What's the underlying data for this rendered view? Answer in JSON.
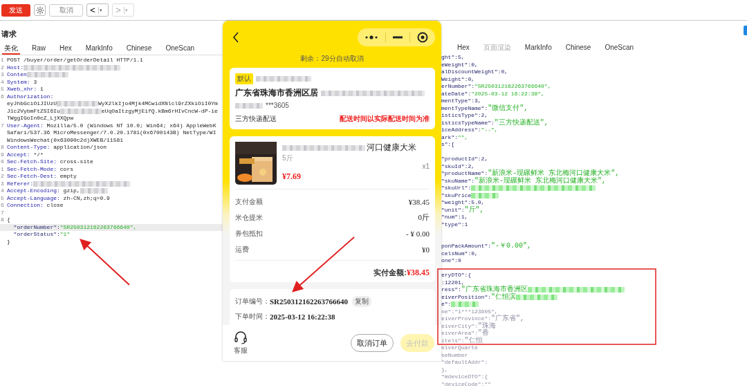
{
  "toolbar": {
    "send": "发送",
    "cancel": "取消",
    "back": "<",
    "forward": ">",
    "caret": "▾"
  },
  "request": {
    "title": "请求",
    "tabs": [
      {
        "label": "美化",
        "selected": true
      },
      {
        "label": "Raw",
        "selected": false
      },
      {
        "label": "Hex",
        "selected": false
      },
      {
        "label": "MarkInfo",
        "selected": false
      },
      {
        "label": "Chinese",
        "selected": false
      },
      {
        "label": "OneScan",
        "selected": false
      }
    ],
    "lines": [
      {
        "no": "1",
        "highlighted": false,
        "parts": [
          {
            "t": "POST /buyer/order/getOrderDetail HTTP/1.1",
            "kind": "plain"
          }
        ]
      },
      {
        "no": "2",
        "highlighted": false,
        "parts": [
          {
            "t": "Host:",
            "kind": "key"
          },
          {
            "kind": "blur-long"
          }
        ]
      },
      {
        "no": "3",
        "highlighted": false,
        "parts": [
          {
            "t": "Conten",
            "kind": "key"
          },
          {
            "kind": "blur-medium"
          }
        ]
      },
      {
        "no": "4",
        "highlighted": false,
        "parts": [
          {
            "t": "System:",
            "kind": "key"
          },
          {
            "t": " 3",
            "kind": "plain"
          }
        ]
      },
      {
        "no": "5",
        "highlighted": false,
        "parts": [
          {
            "t": "Xweb_xhr:",
            "kind": "key"
          },
          {
            "t": " 1",
            "kind": "plain"
          }
        ]
      },
      {
        "no": "6",
        "highlighted": false,
        "parts": [
          {
            "t": "Authorization:",
            "kind": "key"
          }
        ]
      },
      {
        "highlighted": false,
        "parts": [
          {
            "t": "eyJhbGciOiJIUzU",
            "kind": "plain"
          },
          {
            "kind": "blur-medium"
          },
          {
            "t": "WyX2lkIjo4Mjk4MCwidXNlcl9rZXkiOiI0Ym",
            "kind": "plain"
          }
        ]
      },
      {
        "highlighted": false,
        "parts": [
          {
            "t": "J1c2VybmFtZSI6Iu",
            "kind": "plain"
          },
          {
            "kind": "blur-medium"
          },
          {
            "t": "eUqOaItzgyMjEifQ.kBm6rHIvCncW-dP-ie",
            "kind": "plain"
          }
        ]
      },
      {
        "highlighted": false,
        "parts": [
          {
            "t": "TWggIGoIn0cZ_LjXXQpw",
            "kind": "plain"
          }
        ]
      },
      {
        "no": "7",
        "highlighted": false,
        "parts": [
          {
            "t": "User-Agent:",
            "kind": "key"
          },
          {
            "t": " Mozilla/5.0 (Windows NT 10.0; Win64; x64) AppleWebK",
            "kind": "plain"
          }
        ]
      },
      {
        "highlighted": false,
        "parts": [
          {
            "t": "Safari/537.36 MicroMessenger/7.0.20.1781(0x6700143B) NetType/WI",
            "kind": "plain"
          }
        ]
      },
      {
        "highlighted": false,
        "parts": [
          {
            "t": "WindowsWechat(0x63090c2d)XWEB/11581",
            "kind": "plain"
          }
        ]
      },
      {
        "no": "8",
        "highlighted": false,
        "parts": [
          {
            "t": "Content-Type:",
            "kind": "key"
          },
          {
            "t": " application/json",
            "kind": "plain"
          }
        ]
      },
      {
        "no": "9",
        "highlighted": false,
        "parts": [
          {
            "t": "Accept:",
            "kind": "key"
          },
          {
            "t": " */*",
            "kind": "plain"
          }
        ]
      },
      {
        "no": "0",
        "highlighted": false,
        "parts": [
          {
            "t": "Sec-Fetch-Site:",
            "kind": "key"
          },
          {
            "t": " cross-site",
            "kind": "plain"
          }
        ]
      },
      {
        "no": "1",
        "highlighted": false,
        "parts": [
          {
            "t": "Sec-Fetch-Mode:",
            "kind": "key"
          },
          {
            "t": " cors",
            "kind": "plain"
          }
        ]
      },
      {
        "no": "2",
        "highlighted": false,
        "parts": [
          {
            "t": "Sec-Fetch-Dest:",
            "kind": "key"
          },
          {
            "t": " empty",
            "kind": "plain"
          }
        ]
      },
      {
        "no": "3",
        "highlighted": false,
        "parts": [
          {
            "t": "Referer:",
            "kind": "key"
          },
          {
            "kind": "blur-long"
          }
        ]
      },
      {
        "no": "4",
        "highlighted": false,
        "parts": [
          {
            "t": "Accept-Encoding:",
            "kind": "key"
          },
          {
            "t": " gzip,",
            "kind": "plain"
          },
          {
            "kind": "blur-short"
          }
        ]
      },
      {
        "no": "5",
        "highlighted": false,
        "parts": [
          {
            "t": "Accept-Language:",
            "kind": "key"
          },
          {
            "t": " zh-CN,zh;q=0.9",
            "kind": "plain"
          }
        ]
      },
      {
        "no": "6",
        "highlighted": false,
        "parts": [
          {
            "t": "Connection:",
            "kind": "key"
          },
          {
            "t": " close",
            "kind": "plain"
          }
        ]
      },
      {
        "no": "7",
        "highlighted": false
      },
      {
        "no": "8",
        "highlighted": false,
        "parts": [
          {
            "t": "{",
            "kind": "plain"
          }
        ]
      },
      {
        "highlighted": true,
        "parts": [
          {
            "t": "  \"orderNumber\":",
            "kind": "jkey"
          },
          {
            "t": "\"SR250312162263766640\",",
            "kind": "str"
          }
        ]
      },
      {
        "highlighted": false,
        "parts": [
          {
            "t": "  \"orderStatus\":",
            "kind": "jkey"
          },
          {
            "t": "\"1\"",
            "kind": "str"
          }
        ]
      },
      {
        "highlighted": false,
        "parts": [
          {
            "t": "}",
            "kind": "plain"
          }
        ]
      }
    ]
  },
  "phone": {
    "countdown": "剩余：29分自动取消",
    "address": {
      "tag": "默认",
      "line": "广东省珠海市香洲区居",
      "phone": "***3605",
      "delivery": "三方快递配送",
      "note": "配送时间以实际配送时间为准"
    },
    "product": {
      "name": "河口健康大米",
      "spec": "5斤",
      "qty": "x1",
      "price": "¥7.69"
    },
    "fees": [
      {
        "label": "支付金额",
        "value": "¥38.45"
      },
      {
        "label": "米仓提米",
        "value": "0斤"
      },
      {
        "label": "券包抵扣",
        "value": "- ¥ 0.00"
      },
      {
        "label": "运费",
        "value": "¥0"
      }
    ],
    "total_label": "实付金额:",
    "total": "¥38.45",
    "order": [
      {
        "label": "订单编号：",
        "value": "SR250312162263766640",
        "action": "复制"
      },
      {
        "label": "下单时间：",
        "value": "2025-03-12 16:22:38"
      }
    ],
    "service": "客服",
    "buttons": [
      {
        "label": "取消订单",
        "kind": "outline",
        "disabled": false
      },
      {
        "label": "去付款",
        "kind": "primary",
        "disabled": true
      }
    ]
  },
  "response": {
    "tabs": [
      {
        "label": "Hex",
        "selected": false,
        "disabled": false
      },
      {
        "label": "页面渲染",
        "selected": false,
        "disabled": true
      },
      {
        "label": "MarkInfo",
        "selected": false,
        "disabled": false
      },
      {
        "label": "Chinese",
        "selected": false,
        "disabled": false
      },
      {
        "label": "OneScan",
        "selected": false,
        "disabled": false
      }
    ],
    "lines": [
      {
        "parts": [
          {
            "t": "ght\":5,",
            "kind": "jkey"
          }
        ]
      },
      {
        "parts": [
          {
            "t": "eWeight\":0,",
            "kind": "jkey"
          }
        ]
      },
      {
        "parts": [
          {
            "t": "alDiscountWeight\":0,",
            "kind": "jkey"
          }
        ]
      },
      {
        "parts": [
          {
            "t": "Weight\":0,",
            "kind": "jkey"
          }
        ]
      },
      {
        "parts": [
          {
            "t": "erNumber\":",
            "kind": "jkey"
          },
          {
            "t": "\"SR250312162263766640\",",
            "kind": "str"
          }
        ]
      },
      {
        "parts": [
          {
            "t": "ateDate\":",
            "kind": "jkey"
          },
          {
            "t": "\"2025-03-12 16:22:38\",",
            "kind": "str"
          }
        ]
      },
      {
        "parts": [
          {
            "t": "mentType\":3,",
            "kind": "jkey"
          }
        ]
      },
      {
        "parts": [
          {
            "t": "mentTypeName\":",
            "kind": "jkey"
          },
          {
            "t": "\"微信支付\",",
            "kind": "str"
          }
        ]
      },
      {
        "parts": [
          {
            "t": "isticsType\":2,",
            "kind": "jkey"
          }
        ]
      },
      {
        "parts": [
          {
            "t": "isticsTypeName\":",
            "kind": "jkey"
          },
          {
            "t": "\"三方快递配送\",",
            "kind": "str"
          }
        ]
      },
      {
        "parts": [
          {
            "t": "iceAddress\":",
            "kind": "jkey"
          },
          {
            "t": "\"--\",",
            "kind": "str"
          }
        ]
      },
      {
        "parts": [
          {
            "t": "ark\":",
            "kind": "jkey"
          },
          {
            "t": "\"\",",
            "kind": "str"
          }
        ]
      },
      {
        "parts": [
          {
            "t": "s\":[",
            "kind": "jkey"
          }
        ]
      },
      {
        "kind": "blank"
      },
      {
        "parts": [
          {
            "t": "\"productId\":2,",
            "kind": "jkey"
          }
        ]
      },
      {
        "parts": [
          {
            "t": "\"skuId\":2,",
            "kind": "jkey"
          }
        ]
      },
      {
        "parts": [
          {
            "t": "\"productName\":",
            "kind": "jkey"
          },
          {
            "t": "\"新浪米-现碾鲜米 东北梅河口健康大米\",",
            "kind": "str"
          }
        ]
      },
      {
        "parts": [
          {
            "t": "\"skuName\":",
            "kind": "jkey"
          },
          {
            "t": "\"新浪米-现碾鲜米 东北梅河口健康大米\",",
            "kind": "str"
          }
        ]
      },
      {
        "parts": [
          {
            "t": "\"skuUrl\":",
            "kind": "jkey"
          },
          {
            "kind": "blur-xlong"
          }
        ]
      },
      {
        "parts": [
          {
            "t": "\"skuPrice",
            "kind": "jkey"
          },
          {
            "kind": "blur-short"
          }
        ]
      },
      {
        "parts": [
          {
            "t": "\"weight\":5.0,",
            "kind": "jkey"
          }
        ]
      },
      {
        "parts": [
          {
            "t": "\"unit\":",
            "kind": "jkey"
          },
          {
            "t": "\"斤\",",
            "kind": "str"
          }
        ]
      },
      {
        "parts": [
          {
            "t": "\"num\":1,",
            "kind": "jkey"
          }
        ]
      },
      {
        "parts": [
          {
            "t": "\"type\":1",
            "kind": "jkey"
          }
        ]
      },
      {
        "kind": "blank"
      },
      {
        "kind": "blank"
      },
      {
        "parts": [
          {
            "t": "ponPackAmount\":",
            "kind": "jkey"
          },
          {
            "t": "\"-￥0.00\",",
            "kind": "str"
          }
        ]
      },
      {
        "parts": [
          {
            "t": "celsNum\":0,",
            "kind": "jkey"
          }
        ]
      },
      {
        "parts": [
          {
            "t": "one\":0",
            "kind": "jkey"
          }
        ]
      },
      {
        "kind": "blank"
      },
      {
        "parts": [
          {
            "t": "eryDTO\":{",
            "kind": "jkey"
          }
        ]
      },
      {
        "parts": [
          {
            "t": ":12201,",
            "kind": "jkey"
          }
        ]
      },
      {
        "parts": [
          {
            "t": "ress\":",
            "kind": "jkey"
          },
          {
            "t": "\"广东省珠海市香洲区",
            "kind": "str"
          },
          {
            "kind": "blur-long"
          }
        ]
      },
      {
        "parts": [
          {
            "t": "eiverPosition\":",
            "kind": "jkey"
          },
          {
            "t": "\"仁恒滨",
            "kind": "str"
          },
          {
            "kind": "blur-medium"
          }
        ]
      },
      {
        "parts": [
          {
            "t": "e\":",
            "kind": "jkey"
          },
          {
            "kind": "blur-short"
          }
        ]
      },
      {
        "parts": [
          {
            "t": "ne\":",
            "kind": "faint"
          },
          {
            "t": "\"1***123605\",",
            "kind": "faint"
          }
        ]
      },
      {
        "parts": [
          {
            "t": "eiverProvince\":",
            "kind": "faint"
          },
          {
            "t": "\"广东省\",",
            "kind": "faint"
          }
        ]
      },
      {
        "parts": [
          {
            "t": "eiverCity\":",
            "kind": "faint"
          },
          {
            "t": "\"珠海",
            "kind": "faint"
          }
        ]
      },
      {
        "parts": [
          {
            "t": "eiverArea\":",
            "kind": "faint"
          },
          {
            "t": "\"香",
            "kind": "faint"
          }
        ]
      },
      {
        "parts": [
          {
            "t": "itels\":",
            "kind": "faint"
          },
          {
            "t": "\"仁恒",
            "kind": "faint"
          }
        ]
      },
      {
        "parts": [
          {
            "t": "eiverQuarte",
            "kind": "faint"
          }
        ]
      },
      {
        "parts": [
          {
            "t": "seNumber",
            "kind": "faint"
          }
        ]
      },
      {
        "parts": [
          {
            "t": "\"defaultAddr\":",
            "kind": "faint"
          }
        ]
      },
      {
        "parts": [
          {
            "t": "},",
            "kind": "faint"
          }
        ]
      },
      {
        "parts": [
          {
            "t": "\"mdeviceDTO\":{",
            "kind": "faint"
          }
        ]
      },
      {
        "parts": [
          {
            "t": "\"deviceCode\":\"\"",
            "kind": "faint"
          }
        ]
      }
    ]
  }
}
